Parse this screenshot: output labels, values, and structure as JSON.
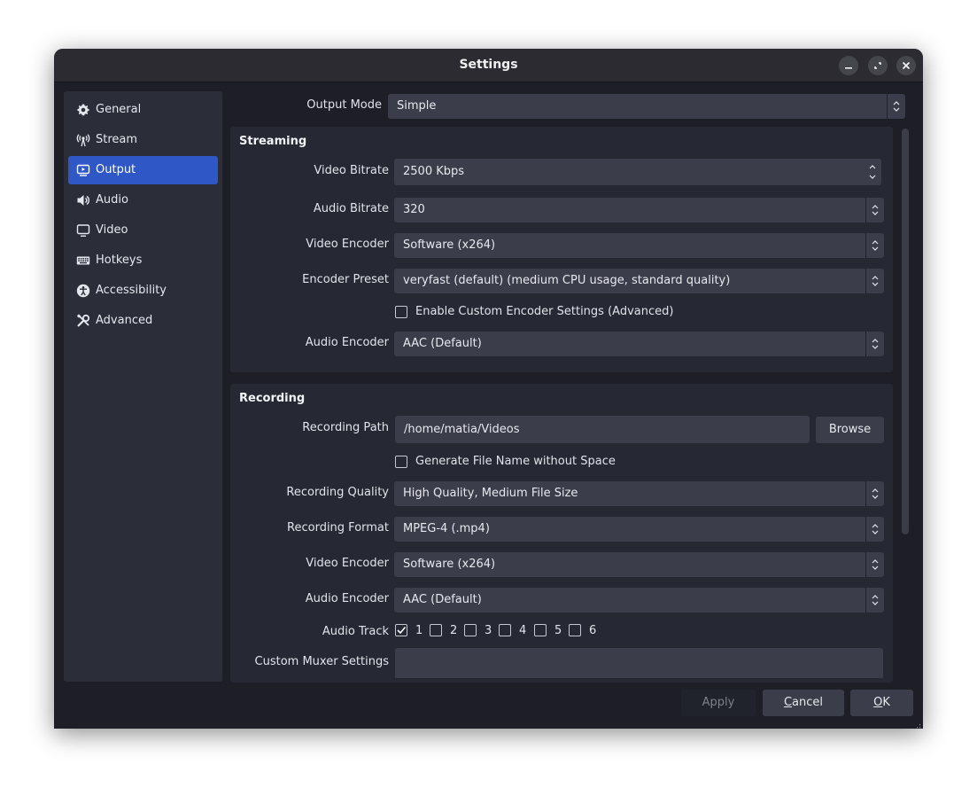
{
  "window": {
    "title": "Settings",
    "controls": {
      "minimize": "minimize-icon",
      "maximize": "maximize-icon",
      "close": "close-icon"
    }
  },
  "sidebar": {
    "items": [
      {
        "label": "General",
        "icon": "gear-icon"
      },
      {
        "label": "Stream",
        "icon": "antenna-icon"
      },
      {
        "label": "Output",
        "icon": "output-icon",
        "selected": true
      },
      {
        "label": "Audio",
        "icon": "speaker-icon"
      },
      {
        "label": "Video",
        "icon": "monitor-icon"
      },
      {
        "label": "Hotkeys",
        "icon": "keyboard-icon"
      },
      {
        "label": "Accessibility",
        "icon": "accessibility-icon"
      },
      {
        "label": "Advanced",
        "icon": "tools-icon"
      }
    ]
  },
  "output_mode": {
    "label": "Output Mode",
    "value": "Simple"
  },
  "streaming": {
    "title": "Streaming",
    "video_bitrate": {
      "label": "Video Bitrate",
      "value": "2500 Kbps"
    },
    "audio_bitrate": {
      "label": "Audio Bitrate",
      "value": "320"
    },
    "video_encoder": {
      "label": "Video Encoder",
      "value": "Software (x264)"
    },
    "encoder_preset": {
      "label": "Encoder Preset",
      "value": "veryfast (default) (medium CPU usage, standard quality)"
    },
    "custom_encoder": {
      "label": "Enable Custom Encoder Settings (Advanced)",
      "checked": false
    },
    "audio_encoder": {
      "label": "Audio Encoder",
      "value": "AAC (Default)"
    }
  },
  "recording": {
    "title": "Recording",
    "path": {
      "label": "Recording Path",
      "value": "/home/matia/Videos",
      "browse": "Browse"
    },
    "no_space": {
      "label": "Generate File Name without Space",
      "checked": false
    },
    "quality": {
      "label": "Recording Quality",
      "value": "High Quality, Medium File Size"
    },
    "format": {
      "label": "Recording Format",
      "value": "MPEG-4 (.mp4)"
    },
    "video_encoder": {
      "label": "Video Encoder",
      "value": "Software (x264)"
    },
    "audio_encoder": {
      "label": "Audio Encoder",
      "value": "AAC (Default)"
    },
    "audio_track": {
      "label": "Audio Track",
      "tracks": [
        {
          "label": "1",
          "checked": true
        },
        {
          "label": "2",
          "checked": false
        },
        {
          "label": "3",
          "checked": false
        },
        {
          "label": "4",
          "checked": false
        },
        {
          "label": "5",
          "checked": false
        },
        {
          "label": "6",
          "checked": false
        }
      ]
    },
    "muxer": {
      "label": "Custom Muxer Settings",
      "value": ""
    }
  },
  "buttons": {
    "apply": "Apply",
    "cancel_mnemonic": "C",
    "cancel_rest": "ancel",
    "ok_mnemonic": "O",
    "ok_rest": "K"
  }
}
